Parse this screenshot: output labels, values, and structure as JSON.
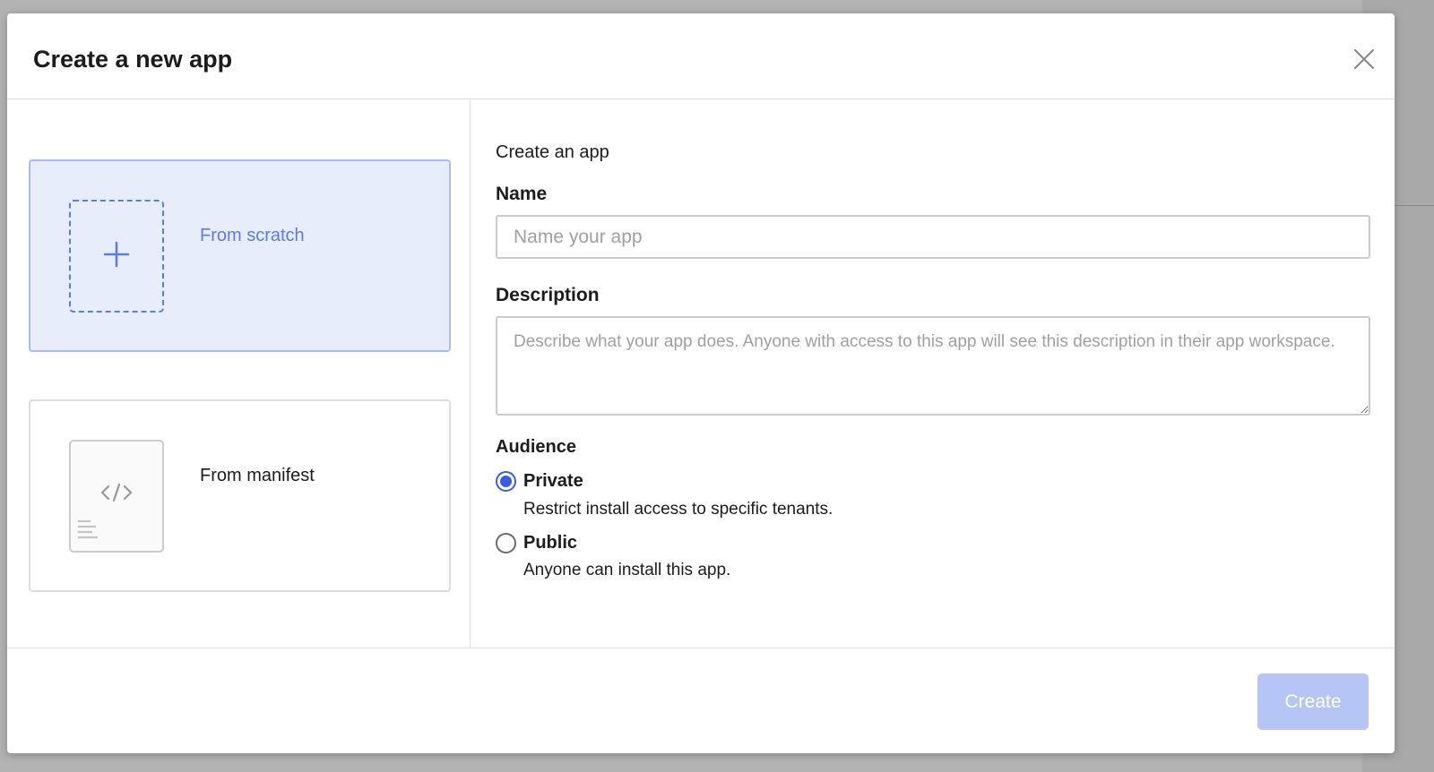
{
  "modal": {
    "title": "Create a new app"
  },
  "options": {
    "scratch": {
      "label": "From scratch",
      "selected": true
    },
    "manifest": {
      "label": "From manifest",
      "selected": false
    }
  },
  "form": {
    "intro": "Create an app",
    "name": {
      "label": "Name",
      "placeholder": "Name your app",
      "value": ""
    },
    "description": {
      "label": "Description",
      "placeholder": "Describe what your app does. Anyone with access to this app will see this description in their app workspace.",
      "value": ""
    },
    "audience": {
      "label": "Audience",
      "selected": "private",
      "options": [
        {
          "id": "private",
          "label": "Private",
          "description": "Restrict install access to specific tenants."
        },
        {
          "id": "public",
          "label": "Public",
          "description": "Anyone can install this app."
        }
      ]
    }
  },
  "footer": {
    "create_label": "Create",
    "create_enabled": false
  },
  "colors": {
    "accent": "#3c5de0",
    "selected_card_bg": "#e8edfb",
    "disabled_button": "#b5c5f5"
  },
  "icons": {
    "close": "close-icon",
    "plus": "plus-icon",
    "code": "code-icon"
  }
}
